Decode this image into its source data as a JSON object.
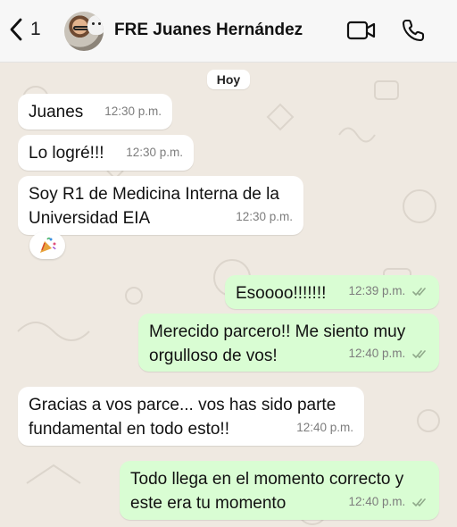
{
  "header": {
    "back_count": "1",
    "contact_name": "FRE Juanes Hernández",
    "icons": [
      "chevron-left-icon",
      "video-call-icon",
      "phone-icon"
    ]
  },
  "chat": {
    "date_label": "Hoy",
    "messages": [
      {
        "direction": "in",
        "text": "Juanes",
        "time": "12:30 p.m."
      },
      {
        "direction": "in",
        "text": "Lo logré!!!",
        "time": "12:30 p.m."
      },
      {
        "direction": "in",
        "line1": "Soy R1 de Medicina Interna de la",
        "line2": "Universidad EIA",
        "time": "12:30 p.m.",
        "reaction": "party-popper-icon"
      },
      {
        "direction": "out",
        "text": "Esoooo!!!!!!!",
        "time": "12:39 p.m.",
        "status": "read"
      },
      {
        "direction": "out",
        "line1": "Merecido parcero!! Me siento muy",
        "line2": "orgulloso de vos!",
        "time": "12:40 p.m.",
        "status": "read"
      },
      {
        "direction": "in",
        "line1": "Gracias a vos parce... vos has sido parte",
        "line2": "fundamental en todo esto!!",
        "time": "12:40 p.m."
      },
      {
        "direction": "out",
        "line1": "Todo llega en el momento correcto y",
        "line2": "este era tu momento",
        "time": "12:40 p.m.",
        "status": "read"
      }
    ]
  },
  "colors": {
    "background": "#efe9e1",
    "incoming_bubble": "#ffffff",
    "outgoing_bubble": "#d9fdd3",
    "read_tick": "#53bdeb"
  }
}
